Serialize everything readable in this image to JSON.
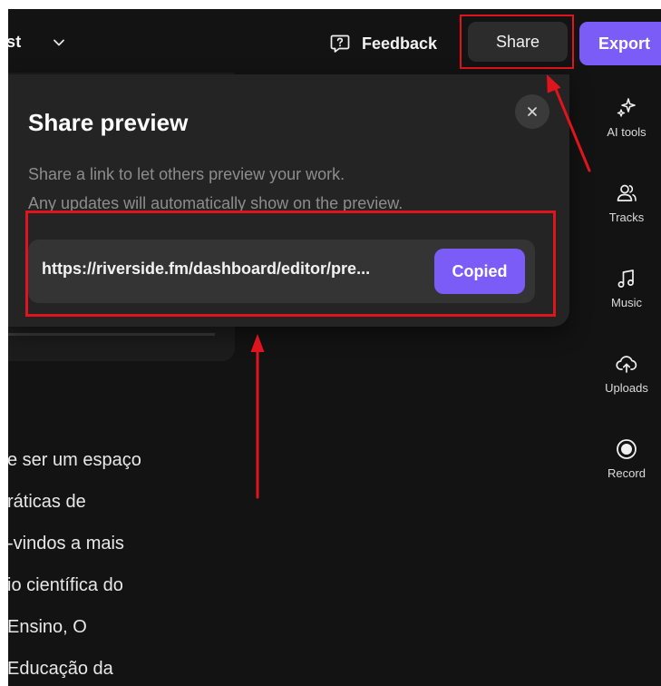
{
  "topbar": {
    "project_title": "st",
    "feedback_label": "Feedback",
    "share_label": "Share",
    "export_label": "Export",
    "icons": [
      "chevron-down-icon",
      "feedback-icon"
    ]
  },
  "sidebar": {
    "items": [
      {
        "label": "AI tools",
        "icon": "sparkles-icon"
      },
      {
        "label": "Tracks",
        "icon": "users-icon"
      },
      {
        "label": "Music",
        "icon": "music-note-icon"
      },
      {
        "label": "Uploads",
        "icon": "cloud-upload-icon"
      },
      {
        "label": "Record",
        "icon": "record-icon"
      }
    ]
  },
  "popup": {
    "title": "Share preview",
    "description_line1": "Share a link to let others preview your work.",
    "description_line2": "Any updates will automatically show on the preview.",
    "link": "https://riverside.fm/dashboard/editor/pre...",
    "copied_label": "Copied",
    "close_icon": "close-icon"
  },
  "document": {
    "lines": [
      "e ser um espaço",
      "ráticas de",
      "-vindos a mais",
      "io científica do",
      " Ensino, O",
      "Educação da"
    ]
  },
  "colors": {
    "background": "#131313",
    "accent": "#7b5cf7",
    "highlight": "#e0141c",
    "popup_bg": "#242424"
  }
}
